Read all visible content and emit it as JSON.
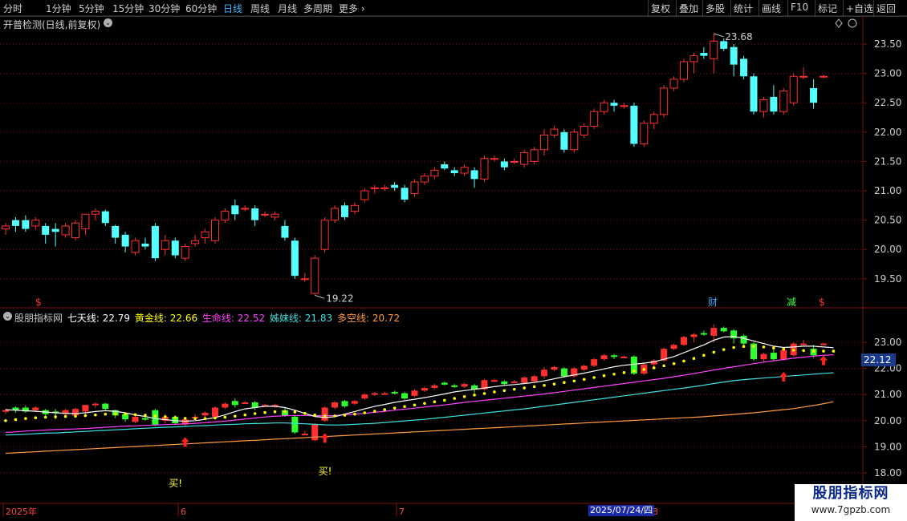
{
  "toolbar": {
    "periods": [
      "分时",
      "1分钟",
      "5分钟",
      "15分钟",
      "30分钟",
      "60分钟",
      "日线",
      "周线",
      "月线",
      "多周期",
      "更多"
    ],
    "active_period": "日线",
    "right_buttons": [
      "复权",
      "叠加",
      "多股",
      "统计",
      "画线",
      "F10",
      "标记",
      "+自选",
      "返回"
    ]
  },
  "main_chart": {
    "title": "开普检测(日线,前复权)",
    "y_ticks": [
      "23.50",
      "23.00",
      "22.50",
      "22.00",
      "21.50",
      "21.00",
      "20.50",
      "20.00",
      "19.50"
    ],
    "high_label": "23.68",
    "low_label": "19.22",
    "markers": {
      "s1": "$",
      "cai": "财",
      "jian": "减",
      "s2": "$"
    }
  },
  "indicator": {
    "name": "股朋指标网",
    "values": [
      {
        "label": "七天线:",
        "value": "22.79",
        "color": "#ffffff"
      },
      {
        "label": "黄金线:",
        "value": "22.66",
        "color": "#ffff00"
      },
      {
        "label": "生命线:",
        "value": "22.52",
        "color": "#ff40ff"
      },
      {
        "label": "姊妹线:",
        "value": "21.83",
        "color": "#40e0e0"
      },
      {
        "label": "多空线:",
        "value": "20.72",
        "color": "#ff9a40"
      }
    ],
    "y_ticks": [
      "23.00",
      "22.00",
      "21.00",
      "20.00",
      "19.00",
      "18.00"
    ],
    "current_price": "22.12",
    "buy_labels": [
      "买!",
      "买!"
    ]
  },
  "time_axis": {
    "labels": [
      "2025年",
      "6",
      "7",
      "8"
    ],
    "highlight_date": "2025/07/24/四"
  },
  "watermark": {
    "line1": "股朋指标网",
    "line2": "www.7gpzb.com"
  },
  "colors": {
    "up": "#ff3030",
    "down": "#54ffff",
    "grid": "#7a1010",
    "white_line": "#ffffff",
    "gold_line": "#ffff00",
    "life_line": "#ff40ff",
    "sister_line": "#40e0e0",
    "bull_bear_line": "#ff9a40"
  },
  "chart_data": {
    "type": "candlestick",
    "price_range": [
      19.0,
      23.8
    ],
    "indicator_range": [
      17.9,
      23.8
    ],
    "candles": [
      {
        "o": 20.35,
        "c": 20.4,
        "h": 20.45,
        "l": 20.25
      },
      {
        "o": 20.5,
        "c": 20.4,
        "h": 20.55,
        "l": 20.3
      },
      {
        "o": 20.5,
        "c": 20.35,
        "h": 20.58,
        "l": 20.3
      },
      {
        "o": 20.4,
        "c": 20.5,
        "h": 20.55,
        "l": 20.33
      },
      {
        "o": 20.4,
        "c": 20.25,
        "h": 20.45,
        "l": 20.1
      },
      {
        "o": 20.35,
        "c": 20.3,
        "h": 20.45,
        "l": 20.05
      },
      {
        "o": 20.25,
        "c": 20.4,
        "h": 20.45,
        "l": 20.2
      },
      {
        "o": 20.2,
        "c": 20.45,
        "h": 20.5,
        "l": 20.15
      },
      {
        "o": 20.35,
        "c": 20.6,
        "h": 20.6,
        "l": 20.25
      },
      {
        "o": 20.6,
        "c": 20.65,
        "h": 20.7,
        "l": 20.5
      },
      {
        "o": 20.65,
        "c": 20.45,
        "h": 20.68,
        "l": 20.4
      },
      {
        "o": 20.4,
        "c": 20.2,
        "h": 20.42,
        "l": 20.1
      },
      {
        "o": 20.25,
        "c": 20.05,
        "h": 20.3,
        "l": 19.95
      },
      {
        "o": 19.95,
        "c": 20.15,
        "h": 20.2,
        "l": 19.9
      },
      {
        "o": 20.1,
        "c": 20.05,
        "h": 20.2,
        "l": 20.0
      },
      {
        "o": 20.4,
        "c": 19.85,
        "h": 20.45,
        "l": 19.8
      },
      {
        "o": 20.0,
        "c": 20.15,
        "h": 20.25,
        "l": 19.9
      },
      {
        "o": 20.15,
        "c": 19.9,
        "h": 20.2,
        "l": 19.85
      },
      {
        "o": 19.85,
        "c": 20.05,
        "h": 20.1,
        "l": 19.8
      },
      {
        "o": 20.1,
        "c": 20.15,
        "h": 20.25,
        "l": 20.05
      },
      {
        "o": 20.2,
        "c": 20.3,
        "h": 20.35,
        "l": 20.1
      },
      {
        "o": 20.15,
        "c": 20.5,
        "h": 20.55,
        "l": 20.1
      },
      {
        "o": 20.5,
        "c": 20.65,
        "h": 20.7,
        "l": 20.45
      },
      {
        "o": 20.75,
        "c": 20.6,
        "h": 20.85,
        "l": 20.5
      },
      {
        "o": 20.7,
        "c": 20.7,
        "h": 20.75,
        "l": 20.65
      },
      {
        "o": 20.7,
        "c": 20.5,
        "h": 20.75,
        "l": 20.4
      },
      {
        "o": 20.6,
        "c": 20.6,
        "h": 20.65,
        "l": 20.55
      },
      {
        "o": 20.55,
        "c": 20.6,
        "h": 20.65,
        "l": 20.5
      },
      {
        "o": 20.4,
        "c": 20.2,
        "h": 20.5,
        "l": 20.15
      },
      {
        "o": 20.15,
        "c": 19.55,
        "h": 20.2,
        "l": 19.5
      },
      {
        "o": 19.5,
        "c": 19.5,
        "h": 19.6,
        "l": 19.45
      },
      {
        "o": 19.25,
        "c": 19.85,
        "h": 19.9,
        "l": 19.22
      },
      {
        "o": 20.0,
        "c": 20.5,
        "h": 20.55,
        "l": 19.95
      },
      {
        "o": 20.5,
        "c": 20.7,
        "h": 20.75,
        "l": 20.45
      },
      {
        "o": 20.75,
        "c": 20.55,
        "h": 20.8,
        "l": 20.5
      },
      {
        "o": 20.65,
        "c": 20.75,
        "h": 20.8,
        "l": 20.6
      },
      {
        "o": 20.85,
        "c": 21.0,
        "h": 21.05,
        "l": 20.8
      },
      {
        "o": 21.05,
        "c": 21.05,
        "h": 21.1,
        "l": 20.95
      },
      {
        "o": 21.05,
        "c": 21.05,
        "h": 21.1,
        "l": 21.0
      },
      {
        "o": 21.1,
        "c": 21.05,
        "h": 21.15,
        "l": 21.0
      },
      {
        "o": 21.05,
        "c": 20.85,
        "h": 21.1,
        "l": 20.8
      },
      {
        "o": 20.95,
        "c": 21.15,
        "h": 21.2,
        "l": 20.9
      },
      {
        "o": 21.15,
        "c": 21.25,
        "h": 21.3,
        "l": 21.1
      },
      {
        "o": 21.25,
        "c": 21.35,
        "h": 21.4,
        "l": 21.2
      },
      {
        "o": 21.45,
        "c": 21.38,
        "h": 21.5,
        "l": 21.35
      },
      {
        "o": 21.35,
        "c": 21.3,
        "h": 21.4,
        "l": 21.25
      },
      {
        "o": 21.3,
        "c": 21.4,
        "h": 21.45,
        "l": 21.25
      },
      {
        "o": 21.35,
        "c": 21.2,
        "h": 21.4,
        "l": 21.05
      },
      {
        "o": 21.2,
        "c": 21.55,
        "h": 21.6,
        "l": 21.15
      },
      {
        "o": 21.55,
        "c": 21.55,
        "h": 21.6,
        "l": 21.5
      },
      {
        "o": 21.5,
        "c": 21.4,
        "h": 21.55,
        "l": 21.35
      },
      {
        "o": 21.5,
        "c": 21.5,
        "h": 21.55,
        "l": 21.45
      },
      {
        "o": 21.45,
        "c": 21.65,
        "h": 21.7,
        "l": 21.4
      },
      {
        "o": 21.5,
        "c": 21.7,
        "h": 21.75,
        "l": 21.45
      },
      {
        "o": 21.7,
        "c": 21.95,
        "h": 22.05,
        "l": 21.6
      },
      {
        "o": 21.95,
        "c": 22.05,
        "h": 22.1,
        "l": 21.9
      },
      {
        "o": 22.0,
        "c": 21.7,
        "h": 22.05,
        "l": 21.65
      },
      {
        "o": 21.7,
        "c": 22.0,
        "h": 22.05,
        "l": 21.65
      },
      {
        "o": 21.95,
        "c": 22.1,
        "h": 22.15,
        "l": 21.9
      },
      {
        "o": 22.1,
        "c": 22.35,
        "h": 22.4,
        "l": 22.05
      },
      {
        "o": 22.35,
        "c": 22.5,
        "h": 22.55,
        "l": 22.3
      },
      {
        "o": 22.5,
        "c": 22.45,
        "h": 22.55,
        "l": 22.35
      },
      {
        "o": 22.45,
        "c": 22.45,
        "h": 22.5,
        "l": 22.4
      },
      {
        "o": 22.45,
        "c": 21.8,
        "h": 22.5,
        "l": 21.75
      },
      {
        "o": 21.8,
        "c": 22.15,
        "h": 22.2,
        "l": 21.75
      },
      {
        "o": 22.15,
        "c": 22.3,
        "h": 22.35,
        "l": 22.05
      },
      {
        "o": 22.3,
        "c": 22.75,
        "h": 22.8,
        "l": 22.25
      },
      {
        "o": 22.75,
        "c": 22.9,
        "h": 22.95,
        "l": 22.7
      },
      {
        "o": 22.9,
        "c": 23.2,
        "h": 23.25,
        "l": 22.85
      },
      {
        "o": 23.2,
        "c": 23.3,
        "h": 23.35,
        "l": 23.0
      },
      {
        "o": 23.35,
        "c": 23.3,
        "h": 23.45,
        "l": 23.25
      },
      {
        "o": 23.25,
        "c": 23.55,
        "h": 23.68,
        "l": 23.0
      },
      {
        "o": 23.55,
        "c": 23.42,
        "h": 23.6,
        "l": 23.38
      },
      {
        "o": 23.45,
        "c": 23.15,
        "h": 23.5,
        "l": 22.95
      },
      {
        "o": 23.25,
        "c": 22.95,
        "h": 23.3,
        "l": 22.9
      },
      {
        "o": 22.95,
        "c": 22.35,
        "h": 23.0,
        "l": 22.3
      },
      {
        "o": 22.35,
        "c": 22.55,
        "h": 22.6,
        "l": 22.25
      },
      {
        "o": 22.6,
        "c": 22.35,
        "h": 22.8,
        "l": 22.3
      },
      {
        "o": 22.35,
        "c": 22.7,
        "h": 22.75,
        "l": 22.3
      },
      {
        "o": 22.5,
        "c": 22.95,
        "h": 23.0,
        "l": 22.45
      },
      {
        "o": 22.95,
        "c": 22.95,
        "h": 23.1,
        "l": 22.9
      },
      {
        "o": 22.75,
        "c": 22.5,
        "h": 22.9,
        "l": 22.4
      },
      {
        "o": 22.95,
        "c": 22.95,
        "h": 22.98,
        "l": 22.92
      }
    ],
    "indicator_lines": {
      "qitian": [
        20.42,
        20.4,
        20.38,
        20.36,
        20.33,
        20.3,
        20.28,
        20.27,
        20.3,
        20.35,
        20.38,
        20.36,
        20.3,
        20.22,
        20.16,
        20.08,
        20.04,
        20.0,
        19.98,
        20.0,
        20.05,
        20.12,
        20.22,
        20.35,
        20.45,
        20.5,
        20.55,
        20.55,
        20.5,
        20.4,
        20.28,
        20.16,
        20.12,
        20.15,
        20.25,
        20.35,
        20.45,
        20.55,
        20.62,
        20.7,
        20.76,
        20.82,
        20.88,
        20.95,
        21.02,
        21.1,
        21.15,
        21.2,
        21.25,
        21.3,
        21.35,
        21.38,
        21.42,
        21.46,
        21.52,
        21.6,
        21.68,
        21.75,
        21.82,
        21.9,
        21.98,
        22.06,
        22.12,
        22.16,
        22.2,
        22.25,
        22.35,
        22.45,
        22.6,
        22.75,
        22.9,
        23.08,
        23.2,
        23.22,
        23.15,
        23.05,
        22.95,
        22.85,
        22.8,
        22.82,
        22.85,
        22.85,
        22.82,
        22.79
      ],
      "gold": [
        20.0,
        20.04,
        20.08,
        20.11,
        20.13,
        20.15,
        20.16,
        20.17,
        20.19,
        20.22,
        20.25,
        20.26,
        20.25,
        20.23,
        20.21,
        20.18,
        20.15,
        20.12,
        20.09,
        20.08,
        20.08,
        20.1,
        20.13,
        20.17,
        20.22,
        20.27,
        20.31,
        20.34,
        20.35,
        20.33,
        20.28,
        20.22,
        20.18,
        20.18,
        20.21,
        20.25,
        20.3,
        20.36,
        20.42,
        20.48,
        20.54,
        20.6,
        20.66,
        20.72,
        20.78,
        20.85,
        20.92,
        20.98,
        21.04,
        21.1,
        21.15,
        21.2,
        21.25,
        21.3,
        21.35,
        21.4,
        21.46,
        21.52,
        21.58,
        21.65,
        21.72,
        21.78,
        21.84,
        21.9,
        21.96,
        22.02,
        22.1,
        22.18,
        22.28,
        22.38,
        22.5,
        22.62,
        22.72,
        22.8,
        22.84,
        22.85,
        22.82,
        22.78,
        22.74,
        22.7,
        22.68,
        22.66,
        22.66,
        22.66
      ],
      "life": [
        19.55,
        19.57,
        19.6,
        19.62,
        19.64,
        19.66,
        19.67,
        19.68,
        19.7,
        19.72,
        19.75,
        19.77,
        19.79,
        19.8,
        19.82,
        19.83,
        19.85,
        19.86,
        19.88,
        19.9,
        19.92,
        19.95,
        19.98,
        20.02,
        20.06,
        20.1,
        20.14,
        20.17,
        20.19,
        20.2,
        20.2,
        20.19,
        20.19,
        20.2,
        20.22,
        20.25,
        20.28,
        20.32,
        20.36,
        20.4,
        20.44,
        20.48,
        20.52,
        20.56,
        20.6,
        20.65,
        20.7,
        20.74,
        20.78,
        20.82,
        20.86,
        20.9,
        20.94,
        20.98,
        21.02,
        21.07,
        21.12,
        21.17,
        21.22,
        21.27,
        21.32,
        21.37,
        21.42,
        21.47,
        21.52,
        21.57,
        21.62,
        21.68,
        21.74,
        21.8,
        21.87,
        21.94,
        22.0,
        22.06,
        22.12,
        22.18,
        22.24,
        22.29,
        22.34,
        22.39,
        22.43,
        22.47,
        22.5,
        22.52
      ],
      "sister": [
        19.45,
        19.46,
        19.48,
        19.5,
        19.52,
        19.53,
        19.55,
        19.57,
        19.59,
        19.61,
        19.63,
        19.65,
        19.67,
        19.69,
        19.71,
        19.73,
        19.75,
        19.76,
        19.78,
        19.8,
        19.81,
        19.83,
        19.85,
        19.86,
        19.88,
        19.89,
        19.9,
        19.91,
        19.91,
        19.9,
        19.88,
        19.86,
        19.84,
        19.83,
        19.84,
        19.86,
        19.88,
        19.9,
        19.93,
        19.96,
        19.99,
        20.02,
        20.05,
        20.09,
        20.13,
        20.17,
        20.21,
        20.25,
        20.29,
        20.33,
        20.37,
        20.41,
        20.45,
        20.5,
        20.55,
        20.6,
        20.65,
        20.7,
        20.75,
        20.8,
        20.85,
        20.9,
        20.95,
        21.0,
        21.05,
        21.1,
        21.15,
        21.2,
        21.25,
        21.3,
        21.36,
        21.42,
        21.48,
        21.53,
        21.57,
        21.6,
        21.63,
        21.66,
        21.69,
        21.72,
        21.75,
        21.78,
        21.81,
        21.83
      ],
      "bull_bear": [
        18.75,
        18.77,
        18.79,
        18.81,
        18.83,
        18.85,
        18.87,
        18.89,
        18.91,
        18.93,
        18.95,
        18.97,
        18.99,
        19.01,
        19.03,
        19.05,
        19.07,
        19.09,
        19.11,
        19.13,
        19.15,
        19.17,
        19.19,
        19.21,
        19.23,
        19.25,
        19.27,
        19.29,
        19.31,
        19.33,
        19.35,
        19.37,
        19.39,
        19.41,
        19.43,
        19.45,
        19.47,
        19.49,
        19.51,
        19.53,
        19.55,
        19.57,
        19.59,
        19.61,
        19.63,
        19.65,
        19.67,
        19.69,
        19.71,
        19.73,
        19.75,
        19.77,
        19.79,
        19.81,
        19.83,
        19.85,
        19.87,
        19.89,
        19.91,
        19.93,
        19.95,
        19.97,
        19.99,
        20.01,
        20.03,
        20.05,
        20.07,
        20.09,
        20.11,
        20.13,
        20.15,
        20.18,
        20.21,
        20.24,
        20.27,
        20.3,
        20.34,
        20.38,
        20.42,
        20.46,
        20.52,
        20.58,
        20.65,
        20.72
      ]
    },
    "buy_arrow_candles": [
      18,
      32,
      78,
      82
    ],
    "buy_label_candles": [
      17,
      32
    ],
    "title": "开普检测(日线,前复权)"
  }
}
